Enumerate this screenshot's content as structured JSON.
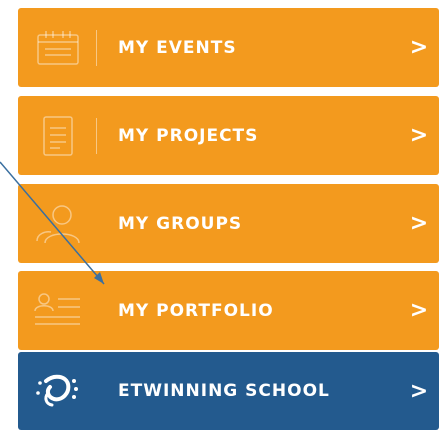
{
  "menu": {
    "items": [
      {
        "label": "MY EVENTS",
        "icon": "calendar-icon",
        "chevron": ">"
      },
      {
        "label": "MY PROJECTS",
        "icon": "document-icon",
        "chevron": ">"
      },
      {
        "label": "MY GROUPS",
        "icon": "user-group-icon",
        "chevron": ">"
      },
      {
        "label": "MY PORTFOLIO",
        "icon": "portfolio-icon",
        "chevron": ">"
      },
      {
        "label": "ETWINNING SCHOOL",
        "icon": "school-badge-icon",
        "chevron": ">"
      }
    ]
  },
  "colors": {
    "orange_tile": "#f39a1e",
    "blue_tile": "#235a8e",
    "text": "#ffffff"
  }
}
